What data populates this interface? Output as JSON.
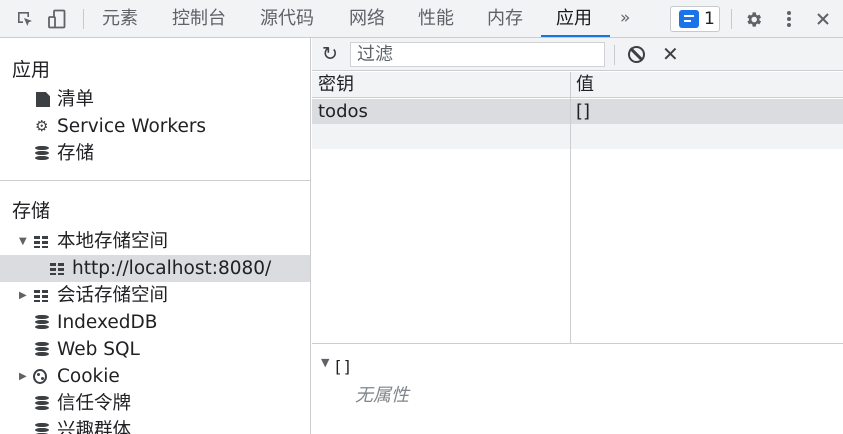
{
  "toolbar": {
    "tabs": [
      "元素",
      "控制台",
      "源代码",
      "网络",
      "性能",
      "内存",
      "应用"
    ],
    "active_tab": "应用",
    "more_label": "»",
    "issues_count": "1",
    "settings_icon": "gear-icon",
    "menu_icon": "kebab-icon",
    "close_icon": "close-icon",
    "accent_color": "#1a73e8"
  },
  "sidebar": {
    "application": {
      "title": "应用",
      "items": [
        "清单",
        "Service Workers",
        "存储"
      ]
    },
    "storage": {
      "title": "存储",
      "local_storage": "本地存储空间",
      "local_origin": "http://localhost:8080/",
      "session_storage": "会话存储空间",
      "indexeddb": "IndexedDB",
      "websql": "Web SQL",
      "cookie": "Cookie",
      "trust_tokens": "信任令牌",
      "interest_groups": "兴趣群体"
    }
  },
  "main": {
    "filter_placeholder": "过滤",
    "table": {
      "headers": [
        "密钥",
        "值"
      ],
      "rows": [
        {
          "key": "todos",
          "value": "[]"
        }
      ]
    },
    "preview": {
      "value": "[]",
      "empty_text": "无属性"
    }
  }
}
